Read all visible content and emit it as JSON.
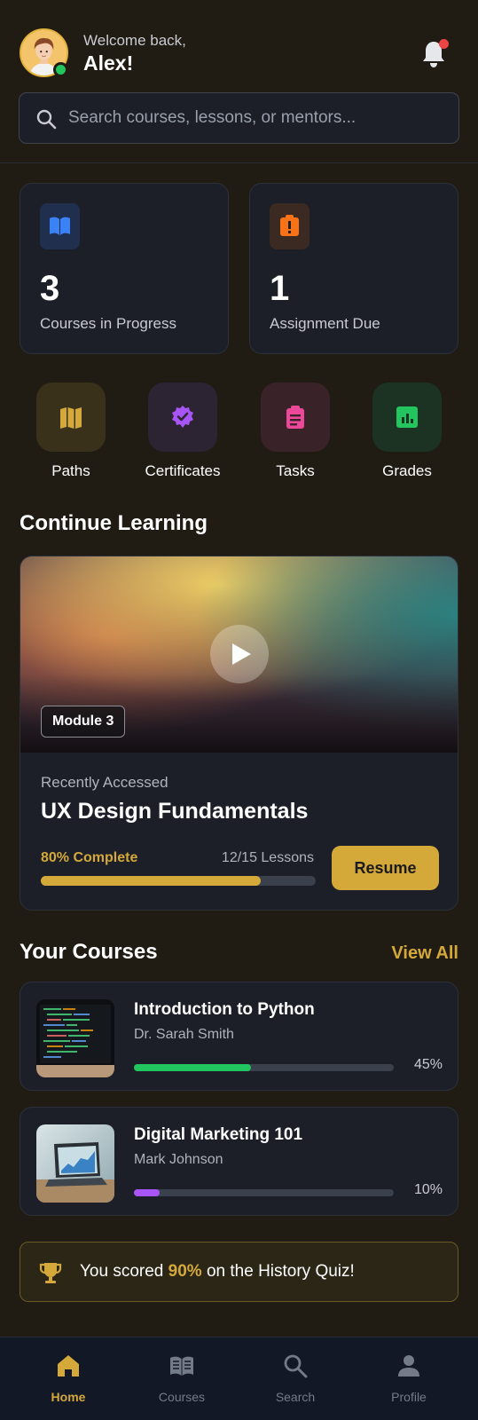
{
  "header": {
    "welcome": "Welcome back,",
    "user_name": "Alex!"
  },
  "search": {
    "placeholder": "Search courses, lessons, or mentors..."
  },
  "stats": [
    {
      "value": "3",
      "label": "Courses in Progress",
      "icon": "book-open-icon",
      "color": "#3b82f6"
    },
    {
      "value": "1",
      "label": "Assignment Due",
      "icon": "alert-clipboard-icon",
      "color": "#f97316"
    }
  ],
  "quick_links": [
    {
      "label": "Paths",
      "icon": "map-icon",
      "color": "#d4a93a"
    },
    {
      "label": "Certificates",
      "icon": "verified-badge-icon",
      "color": "#a855f7"
    },
    {
      "label": "Tasks",
      "icon": "clipboard-list-icon",
      "color": "#ec4899"
    },
    {
      "label": "Grades",
      "icon": "chart-bar-icon",
      "color": "#22c55e"
    }
  ],
  "continue_learning": {
    "section_title": "Continue Learning",
    "module": "Module 3",
    "recent_label": "Recently Accessed",
    "course_title": "UX Design Fundamentals",
    "progress_text": "80% Complete",
    "progress": 0.8,
    "lessons_text": "12/15 Lessons",
    "resume_label": "Resume"
  },
  "courses": {
    "section_title": "Your Courses",
    "view_all": "View All",
    "items": [
      {
        "title": "Introduction to Python",
        "mentor": "Dr. Sarah Smith",
        "progress": 0.45,
        "percent_text": "45%",
        "color": "#22c55e"
      },
      {
        "title": "Digital Marketing 101",
        "mentor": "Mark Johnson",
        "progress": 0.1,
        "percent_text": "10%",
        "color": "#a855f7"
      }
    ]
  },
  "achievement": {
    "prefix": "You scored ",
    "highlight": "90%",
    "suffix": " on the History Quiz!"
  },
  "nav": [
    {
      "label": "Home",
      "icon": "home-icon",
      "active": true
    },
    {
      "label": "Courses",
      "icon": "book-icon",
      "active": false
    },
    {
      "label": "Search",
      "icon": "search-icon",
      "active": false
    },
    {
      "label": "Profile",
      "icon": "profile-icon",
      "active": false
    }
  ],
  "colors": {
    "accent": "#d4a93a",
    "background": "#201c13",
    "card": "#1c1f28"
  }
}
